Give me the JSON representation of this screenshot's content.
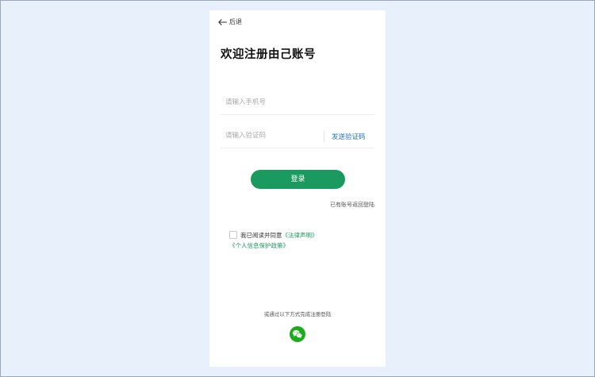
{
  "colors": {
    "page_background": "#e8f0fc",
    "card_background": "#ffffff",
    "accent_green": "#1a9a5f",
    "link_blue": "#1f6fd0",
    "wechat_green": "#1aad19"
  },
  "header": {
    "back_icon": "arrow-left-icon",
    "back_label": "后退"
  },
  "page_title": "欢迎注册由己账号",
  "form": {
    "phone_placeholder": "请输入手机号",
    "phone_value": "",
    "code_placeholder": "请输入验证码",
    "code_value": "",
    "send_code_label": "发送验证码"
  },
  "login_button_label": "登录",
  "back_to_login_label": "已有账号返回登陆",
  "agreement": {
    "checked": false,
    "prefix": "我已阅读并同意",
    "legal_link": "《法律声明》",
    "privacy_link": "《个人信息保护政策》"
  },
  "alt_login": {
    "text": "或通过以下方式完成注册登陆",
    "icon": "wechat-icon"
  }
}
